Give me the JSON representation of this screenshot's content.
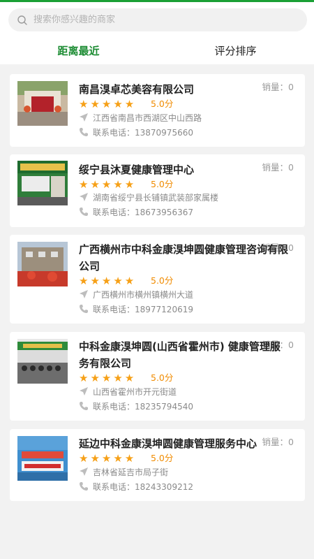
{
  "search": {
    "placeholder": "搜索你感兴趣的商家"
  },
  "tabs": [
    {
      "label": "距离最近",
      "active": true
    },
    {
      "label": "评分排序",
      "active": false
    }
  ],
  "colors": {
    "accent": "#1c8c33",
    "star": "#f6a017",
    "score": "#f08b00"
  },
  "stores": [
    {
      "name": "南昌湨卓芯美容有限公司",
      "sales": "销量：0",
      "rating": 5,
      "rating_stars": "★★★★★",
      "score": "5.0分",
      "address": "江西省南昌市西湖区中山西路",
      "phone": "联系电话：13870975660"
    },
    {
      "name": "绥宁县沐夏健康管理中心",
      "sales": "销量：0",
      "rating": 5,
      "rating_stars": "★★★★★",
      "score": "5.0分",
      "address": "湖南省绥宁县长铺镇武装部家属楼",
      "phone": "联系电话：18673956367"
    },
    {
      "name": "广西横州市中科金康湨坤圆健康管理咨询有限公司",
      "sales": "销量：0",
      "rating": 5,
      "rating_stars": "★★★★★",
      "score": "5.0分",
      "address": "广西横州市横州镇横州大道",
      "phone": "联系电话：18977120619"
    },
    {
      "name": "中科金康湨坤圆(山西省霍州市) 健康管理服务有限公司",
      "sales": "销量：0",
      "rating": 5,
      "rating_stars": "★★★★★",
      "score": "5.0分",
      "address": "山西省霍州市开元街道",
      "phone": "联系电话：18235794540"
    },
    {
      "name": "延边中科金康湨坤圆健康管理服务中心",
      "sales": "销量：0",
      "rating": 5,
      "rating_stars": "★★★★★",
      "score": "5.0分",
      "address": "吉林省延吉市局子街",
      "phone": "联系电话：18243309212"
    }
  ]
}
